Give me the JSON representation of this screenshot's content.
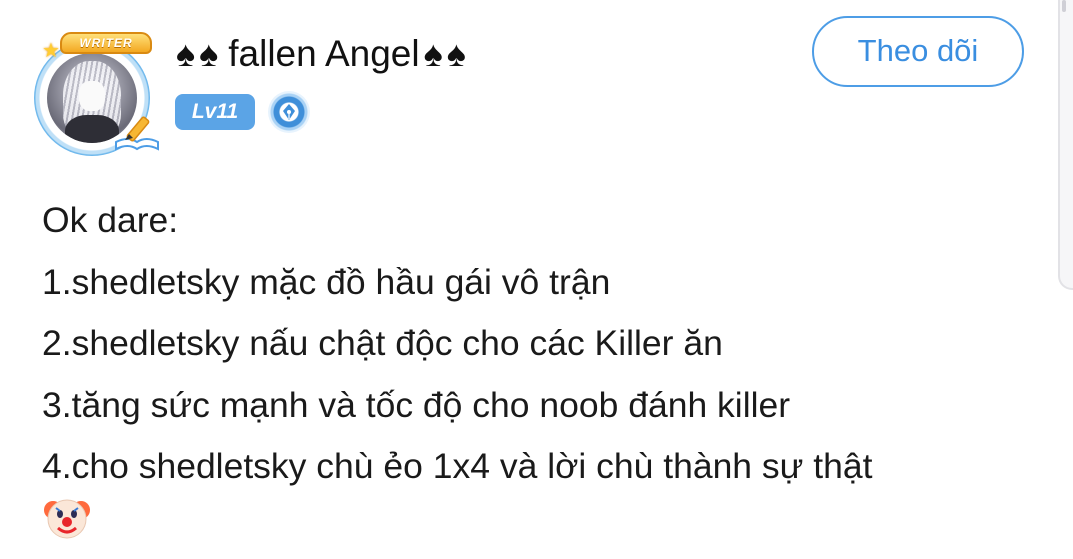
{
  "post": {
    "author": {
      "avatar_badge": "WRITER",
      "name": "fallen Angel",
      "name_decoration": "♠",
      "level": "Lv11",
      "title_icon": "quill-pen-icon"
    },
    "follow_label": "Theo dõi",
    "body_lines": [
      "Ok dare:",
      "1.shedletsky mặc đồ hầu gái vô trận",
      "2.shedletsky nấu chật độc cho các Killer ăn",
      "3.tăng sức mạnh và tốc độ cho noob đánh killer",
      "4.cho shedletsky chù ẻo 1x4 và lời chù thành sự thật"
    ],
    "trailing_emoji": "clown-face-icon"
  },
  "colors": {
    "accent": "#4d9de6",
    "level_badge": "#5ba4e6",
    "text": "#1a1a1a",
    "background": "#ffffff"
  }
}
